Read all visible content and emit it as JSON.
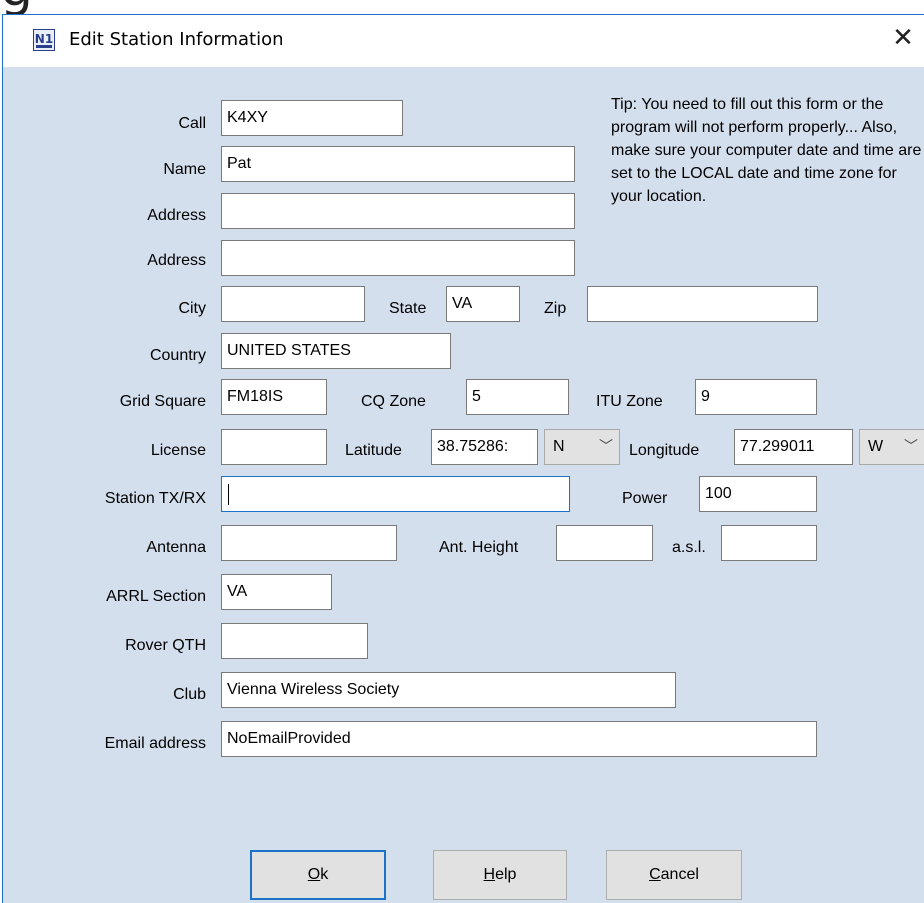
{
  "background_glyph": "g",
  "window": {
    "icon_text": "N1",
    "title": "Edit Station Information",
    "close_glyph": "✕"
  },
  "tip": "Tip: You need to fill out this form or the program will not perform properly... Also, make sure your computer date and time are set to the LOCAL date and time zone for your location.",
  "fields": {
    "call": {
      "label": "Call",
      "value": "K4XY"
    },
    "name": {
      "label": "Name",
      "value": "Pat"
    },
    "address1": {
      "label": "Address",
      "value": ""
    },
    "address2": {
      "label": "Address",
      "value": ""
    },
    "city": {
      "label": "City",
      "value": ""
    },
    "state": {
      "label": "State",
      "value": "VA"
    },
    "zip": {
      "label": "Zip",
      "value": ""
    },
    "country": {
      "label": "Country",
      "value": "UNITED STATES"
    },
    "grid_square": {
      "label": "Grid Square",
      "value": "FM18IS"
    },
    "cq_zone": {
      "label": "CQ Zone",
      "value": "5"
    },
    "itu_zone": {
      "label": "ITU Zone",
      "value": "9"
    },
    "license": {
      "label": "License",
      "value": ""
    },
    "latitude": {
      "label": "Latitude",
      "value": "38.75286:",
      "hemisphere": "N"
    },
    "longitude": {
      "label": "Longitude",
      "value": "77.299011",
      "hemisphere": "W"
    },
    "station": {
      "label": "Station TX/RX",
      "value": ""
    },
    "power": {
      "label": "Power",
      "value": "100"
    },
    "antenna": {
      "label": "Antenna",
      "value": ""
    },
    "ant_height": {
      "label": "Ant. Height",
      "value": ""
    },
    "asl": {
      "label": "a.s.l.",
      "value": ""
    },
    "arrl_section": {
      "label": "ARRL Section",
      "value": "VA"
    },
    "rover_qth": {
      "label": "Rover QTH",
      "value": ""
    },
    "club": {
      "label": "Club",
      "value": "Vienna Wireless Society"
    },
    "email": {
      "label": "Email address",
      "value": "NoEmailProvided"
    }
  },
  "buttons": {
    "ok": {
      "mnemonic": "O",
      "rest": "k"
    },
    "help": {
      "mnemonic": "H",
      "rest": "elp"
    },
    "cancel": {
      "mnemonic": "C",
      "rest": "ancel"
    }
  },
  "colors": {
    "dialog_bg": "#d4dfee",
    "focus_border": "#1a73c8"
  }
}
